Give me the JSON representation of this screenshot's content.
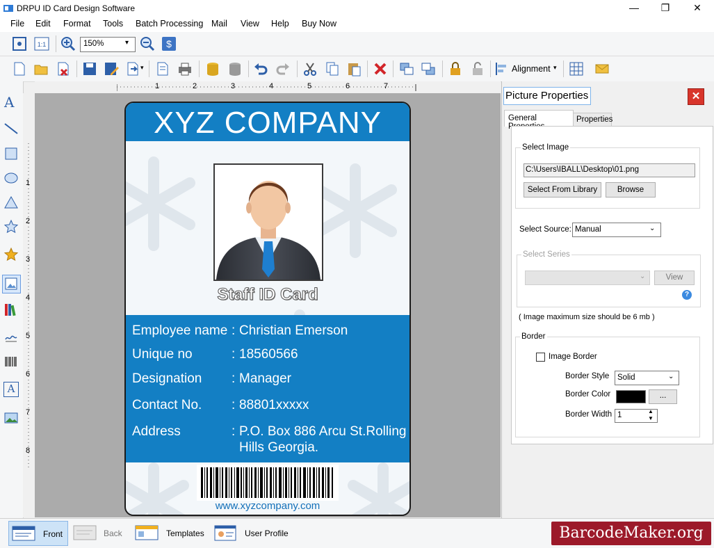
{
  "app": {
    "title": "DRPU ID Card Design Software"
  },
  "window_controls": {
    "minimize": "—",
    "maximize": "❐",
    "close": "✕"
  },
  "menu": [
    "File",
    "Edit",
    "Format",
    "Tools",
    "Batch Processing",
    "Mail",
    "View",
    "Help",
    "Buy Now"
  ],
  "toolbar1": {
    "zoom_value": "150%"
  },
  "toolbar2": {
    "alignment_label": "Alignment"
  },
  "ruler": {
    "h_ticks": [
      "1",
      "2",
      "3",
      "4",
      "5",
      "6",
      "7"
    ],
    "v_ticks": [
      "1",
      "2",
      "3",
      "4",
      "5",
      "6",
      "7",
      "8"
    ]
  },
  "card": {
    "company": "XYZ COMPANY",
    "staff_label": "Staff ID Card",
    "fields": [
      {
        "label": "Employee name",
        "value": "Christian Emerson"
      },
      {
        "label": "Unique no",
        "value": "18560566"
      },
      {
        "label": "Designation",
        "value": "Manager"
      },
      {
        "label": "Contact No.",
        "value": "88801xxxxx"
      },
      {
        "label": "Address",
        "value": "P.O. Box 886 Arcu St.Rolling Hills Georgia."
      }
    ],
    "colon": ":",
    "website": "www.xyzcompany.com",
    "head_color": "#137fc4"
  },
  "panel": {
    "title": "Picture Properties",
    "tabs": [
      "General Properties",
      "Properties"
    ],
    "select_image_legend": "Select Image",
    "image_path": "C:\\Users\\IBALL\\Desktop\\01.png",
    "select_library_btn": "Select From Library",
    "browse_btn": "Browse",
    "select_source_label": "Select Source:",
    "select_source_value": "Manual",
    "select_series_legend": "Select Series",
    "view_btn": "View",
    "help_icon": "?",
    "max_size_note": "( Image maximum size should be 6 mb )",
    "border_legend": "Border",
    "image_border_label": "Image Border",
    "border_style_label": "Border Style",
    "border_style_value": "Solid",
    "border_color_label": "Border Color",
    "border_color_btn": "...",
    "border_color_value": "#000000",
    "border_width_label": "Border Width",
    "border_width_value": "1"
  },
  "bottom": {
    "front": "Front",
    "back": "Back",
    "templates": "Templates",
    "user_profile": "User Profile"
  },
  "watermark": "BarcodeMaker.org"
}
